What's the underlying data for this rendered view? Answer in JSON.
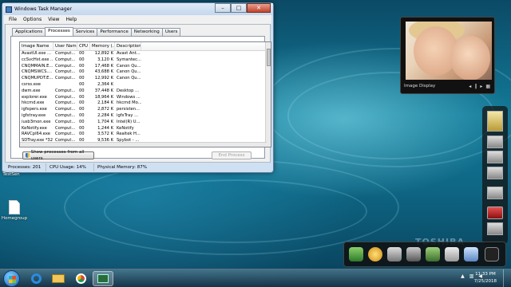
{
  "window": {
    "title": "Windows Task Manager",
    "menu": [
      "File",
      "Options",
      "View",
      "Help"
    ],
    "controls": {
      "minimize": "–",
      "maximize": "□",
      "close": "✕"
    }
  },
  "tabs": [
    "Applications",
    "Processes",
    "Services",
    "Performance",
    "Networking",
    "Users"
  ],
  "active_tab": "Processes",
  "columns": [
    "Image Name",
    "User Name",
    "CPU",
    "Memory (...",
    "Description"
  ],
  "processes": [
    [
      "AvastUI.exe ...",
      "Comput...",
      "00",
      "12,892 K",
      "Avast Ant..."
    ],
    [
      "ccSvcHst.exe ...",
      "Comput...",
      "00",
      "3,120 K",
      "Symantec..."
    ],
    [
      "CNQMMAIN.E...",
      "Comput...",
      "00",
      "17,468 K",
      "Canon Qu..."
    ],
    [
      "CNQMSWCS....",
      "Comput...",
      "00",
      "43,688 K",
      "Canon Qu..."
    ],
    [
      "CNQMUPDT.E...",
      "Comput...",
      "00",
      "12,992 K",
      "Canon Qu..."
    ],
    [
      "csrss.exe",
      "",
      "00",
      "2,364 K",
      ""
    ],
    [
      "dwm.exe",
      "Comput...",
      "00",
      "37,448 K",
      "Desktop ..."
    ],
    [
      "explorer.exe",
      "Comput...",
      "00",
      "18,964 K",
      "Windows ..."
    ],
    [
      "hkcmd.exe",
      "Comput...",
      "00",
      "2,184 K",
      "hkcmd Mo..."
    ],
    [
      "igfxpers.exe",
      "Comput...",
      "00",
      "2,872 K",
      "persisten..."
    ],
    [
      "igfxtray.exe",
      "Comput...",
      "00",
      "2,284 K",
      "igfxTray ..."
    ],
    [
      "iusb3mon.exe",
      "Comput...",
      "00",
      "1,704 K",
      "Intel(R) U..."
    ],
    [
      "KeNotify.exe",
      "Comput...",
      "00",
      "1,244 K",
      "KeNotify"
    ],
    [
      "RAVCpl64.exe",
      "Comput...",
      "00",
      "3,572 K",
      "Realtek H..."
    ],
    [
      "SDTray.exe *32",
      "Comput...",
      "00",
      "9,536 K",
      "Spybot - ..."
    ]
  ],
  "buttons": {
    "show_all": "Show processes from all users",
    "end_process": "End Process"
  },
  "status": {
    "processes": "Processes: 201",
    "cpu": "CPU Usage: 14%",
    "memory": "Physical Memory: 87%"
  },
  "desktop_icons": [
    "TestSen",
    "Homegroup"
  ],
  "gadget": {
    "label": "Image Display",
    "controls": [
      "◂",
      "‖",
      "▸",
      "▦"
    ]
  },
  "watermark": "TOSHIBA",
  "clock": {
    "time": "11:33 PM",
    "date": "7/25/2018"
  },
  "colors": {
    "desktop": "#127a98",
    "window": "#cfe0f2",
    "taskbar": "#1a3c52"
  }
}
